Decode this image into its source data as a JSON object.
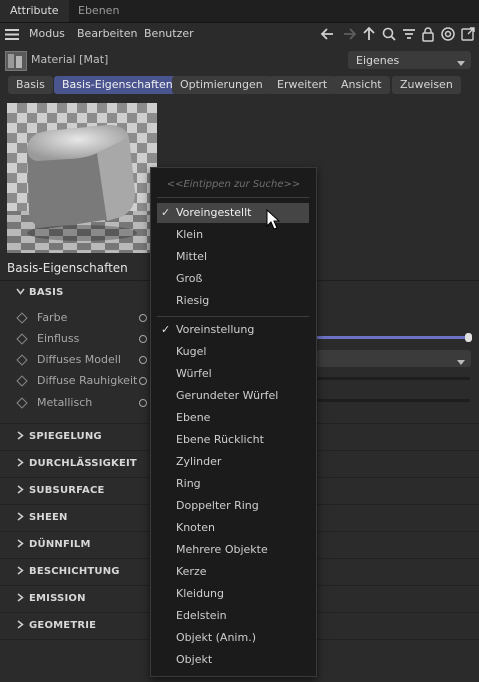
{
  "tabs": [
    "Attribute",
    "Ebenen"
  ],
  "menu": {
    "items": [
      "Modus",
      "Bearbeiten",
      "Benutzer"
    ]
  },
  "toolbar_icons": [
    "arrow-left-icon",
    "arrow-right-icon",
    "arrow-up-icon",
    "search-icon",
    "filter-icon",
    "lock-icon",
    "target-icon",
    "external-icon"
  ],
  "material": {
    "name": "Material [Mat]",
    "preset_select": "Eigenes"
  },
  "buttons": [
    "Basis",
    "Basis-Eigenschaften",
    "Optimierungen",
    "Erweitert",
    "Ansicht",
    "Zuweisen"
  ],
  "active_button": "Basis-Eigenschaften",
  "section_title": "Basis-Eigenschaften",
  "basis_group": {
    "title": "BASIS",
    "params": [
      "Farbe",
      "Einfluss",
      "Diffuses Modell",
      "Diffuse Rauhigkeit",
      "Metallisch"
    ]
  },
  "groups": [
    "SPIEGELUNG",
    "DURCHLÄSSIGKEIT",
    "SUBSURFACE",
    "SHEEN",
    "DÜNNFILM",
    "BESCHICHTUNG",
    "EMISSION",
    "GEOMETRIE"
  ],
  "dropdown": {
    "search_placeholder": "<<Eintippen zur Suche>>",
    "size_items": [
      "Voreingestellt",
      "Klein",
      "Mittel",
      "Groß",
      "Riesig"
    ],
    "size_selected": "Voreingestellt",
    "object_items": [
      "Voreinstellung",
      "Kugel",
      "Würfel",
      "Gerundeter Würfel",
      "Ebene",
      "Ebene Rücklicht",
      "Zylinder",
      "Ring",
      "Doppelter Ring",
      "Knoten",
      "Mehrere Objekte",
      "Kerze",
      "Kleidung",
      "Edelstein",
      "Objekt (Anim.)",
      "Objekt"
    ],
    "object_selected": "Voreinstellung"
  },
  "colors": {
    "accent": "#4a5590",
    "slider": "#6c72c4",
    "background": "#2b2b2b",
    "menu_bg": "#1b1b1b"
  }
}
